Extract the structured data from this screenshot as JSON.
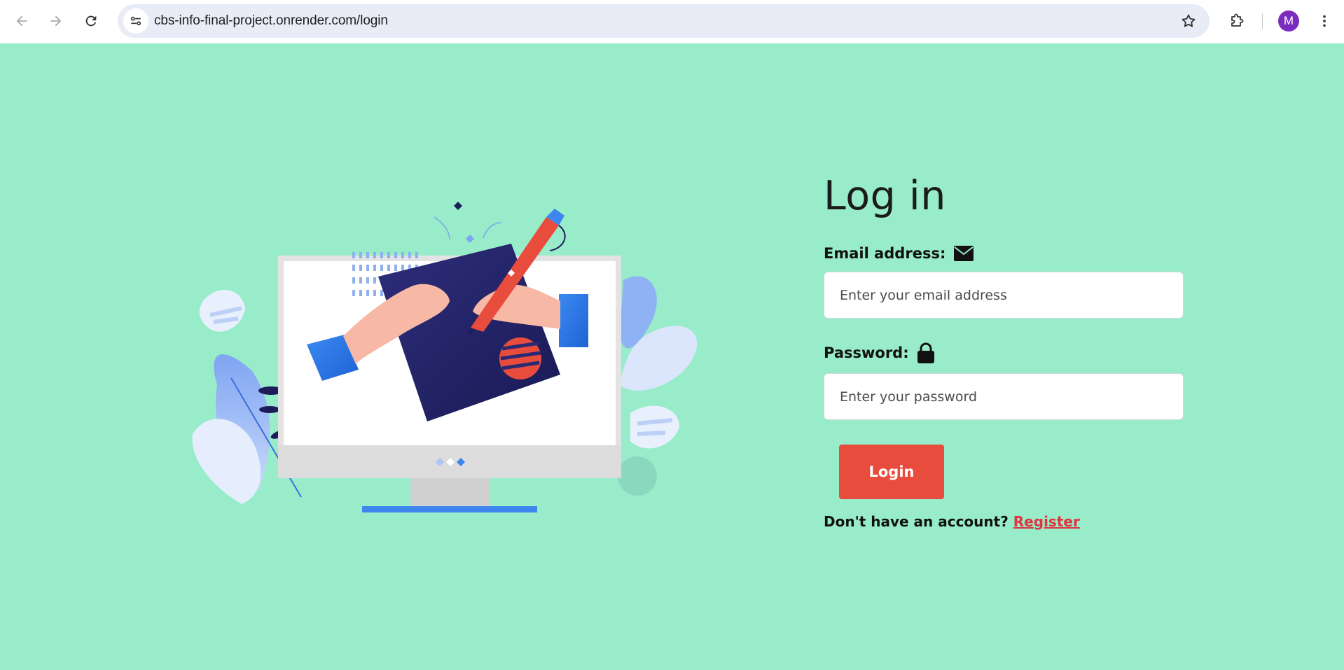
{
  "browser": {
    "url": "cbs-info-final-project.onrender.com/login",
    "avatar_initial": "M",
    "icons": [
      "back-arrow-icon",
      "forward-arrow-icon",
      "reload-icon",
      "site-info-icon",
      "bookmark-star-icon",
      "extensions-icon",
      "more-menu-icon"
    ]
  },
  "login": {
    "title": "Log in",
    "email_label": "Email address:",
    "email_placeholder": "Enter your email address",
    "email_value": "",
    "password_label": "Password:",
    "password_placeholder": "Enter your password",
    "password_value": "",
    "button_label": "Login",
    "register_prompt": "Don't have an account?",
    "register_link": "Register"
  },
  "colors": {
    "page_background": "#98ecca",
    "button": "#e84c3d",
    "link": "#e0343f",
    "avatar": "#7b2cbf"
  }
}
